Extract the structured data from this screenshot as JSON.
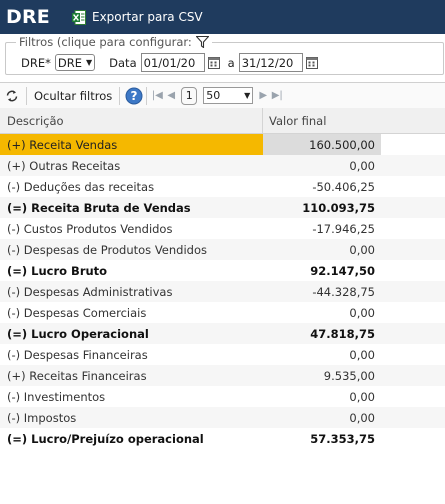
{
  "header": {
    "title": "DRE",
    "export_label": "Exportar para CSV"
  },
  "filters": {
    "legend": "Filtros (clique para configurar:",
    "dre_label": "DRE*",
    "dre_value": "DRE",
    "data_label": "Data",
    "date_from": "01/01/20",
    "between_label": "a",
    "date_to": "31/12/20"
  },
  "toolbar": {
    "hide_filters_label": "Ocultar filtros",
    "page": "1",
    "page_size": "50"
  },
  "grid": {
    "columns": [
      "Descrição",
      "Valor final"
    ],
    "rows": [
      {
        "desc": "(+) Receita Vendas",
        "value": "160.500,00"
      },
      {
        "desc": "(+) Outras Receitas",
        "value": "0,00"
      },
      {
        "desc": "(-) Deduções das receitas",
        "value": "-50.406,25"
      },
      {
        "desc": "(=) Receita Bruta de Vendas",
        "value": "110.093,75"
      },
      {
        "desc": "(-) Custos Produtos Vendidos",
        "value": "-17.946,25"
      },
      {
        "desc": "(-) Despesas de Produtos Vendidos",
        "value": "0,00"
      },
      {
        "desc": "(=) Lucro Bruto",
        "value": "92.147,50"
      },
      {
        "desc": "(-) Despesas Administrativas",
        "value": "-44.328,75"
      },
      {
        "desc": "(-) Despesas Comerciais",
        "value": "0,00"
      },
      {
        "desc": "(=) Lucro Operacional",
        "value": "47.818,75"
      },
      {
        "desc": "(-) Despesas Financeiras",
        "value": "0,00"
      },
      {
        "desc": "(+) Receitas Financeiras",
        "value": "9.535,00"
      },
      {
        "desc": "(-) Investimentos",
        "value": "0,00"
      },
      {
        "desc": "(-) Impostos",
        "value": "0,00"
      },
      {
        "desc": "(=) Lucro/Prejuízo operacional",
        "value": "57.353,75"
      }
    ]
  },
  "colors": {
    "header_bg": "#1f3b5e",
    "selected_row": "#f5b800"
  }
}
